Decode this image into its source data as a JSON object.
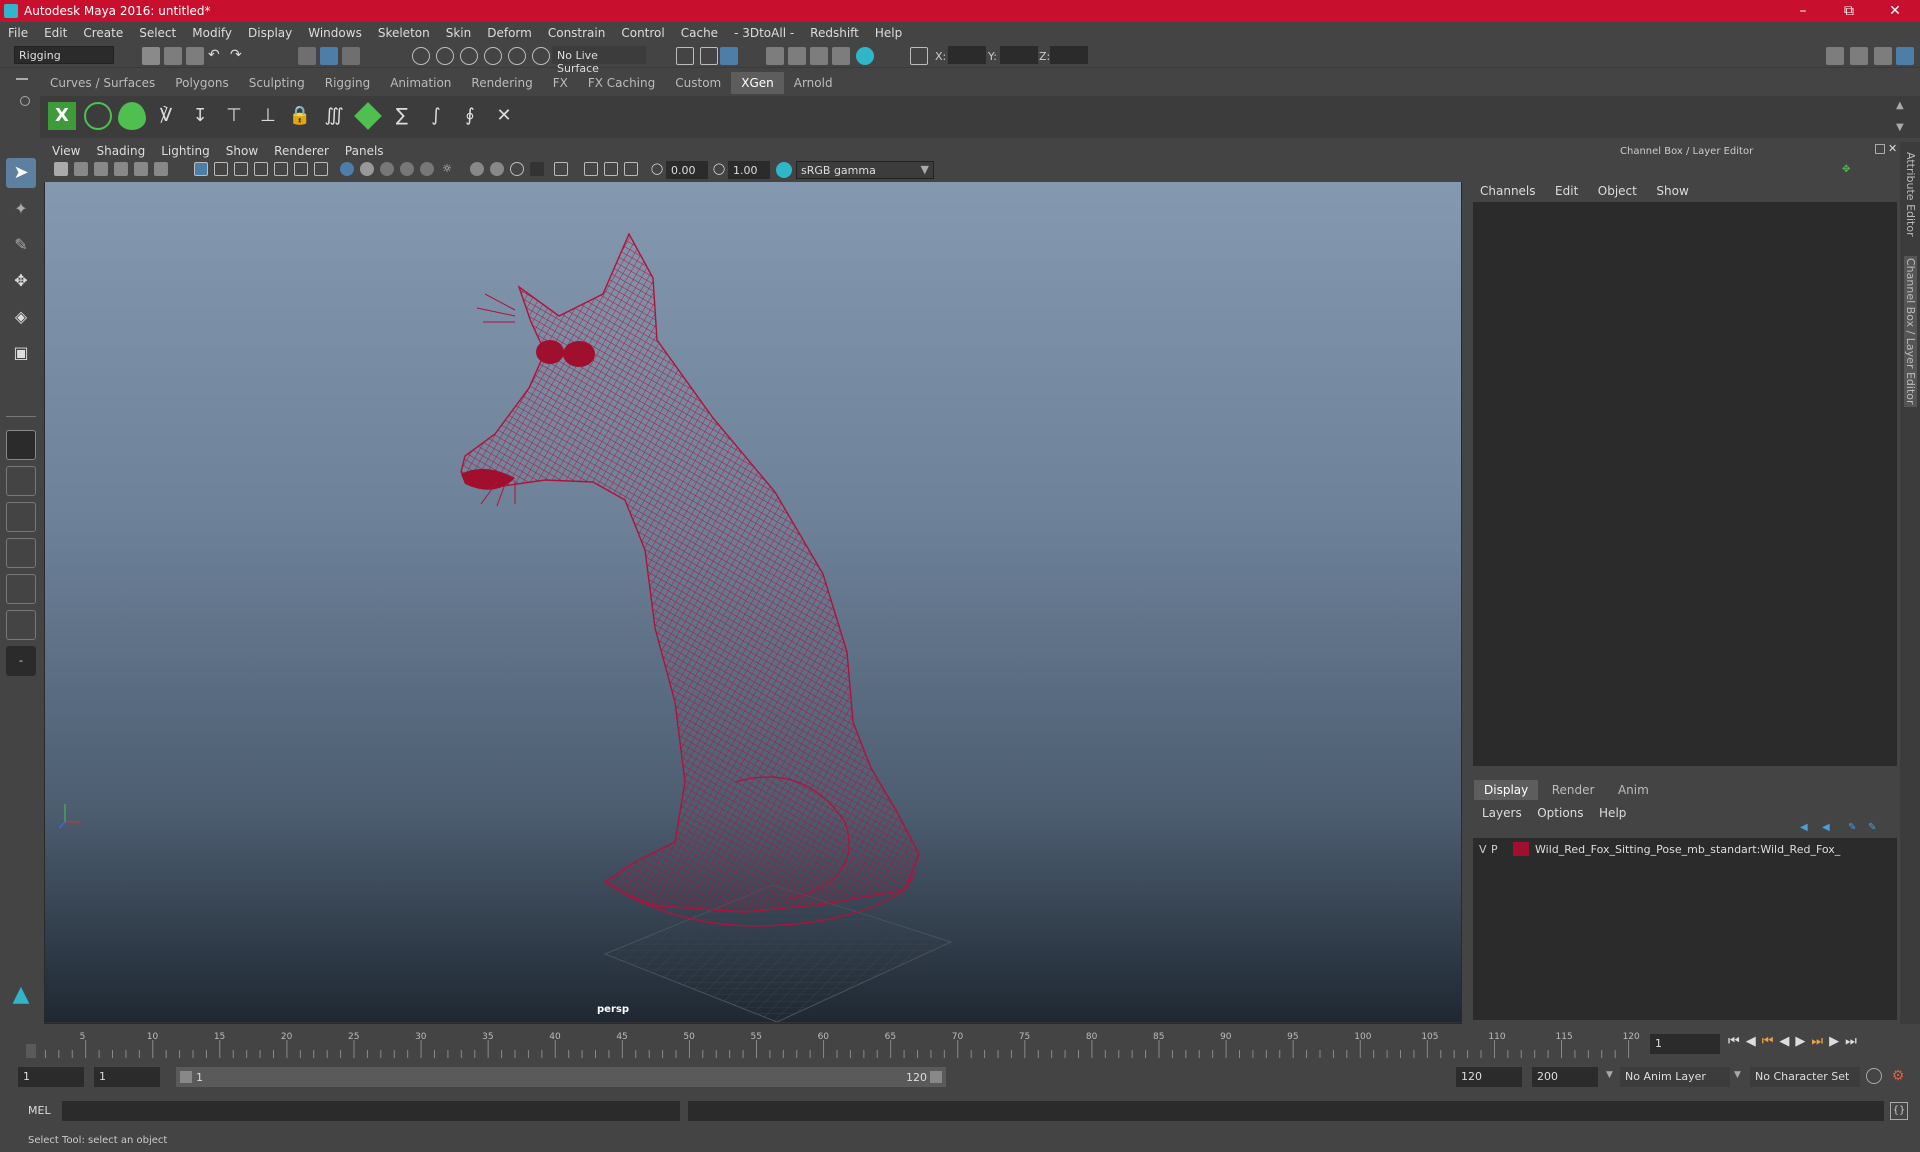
{
  "window": {
    "title": "Autodesk Maya 2016: untitled*"
  },
  "menubar": [
    "File",
    "Edit",
    "Create",
    "Select",
    "Modify",
    "Display",
    "Windows",
    "Skeleton",
    "Skin",
    "Deform",
    "Constrain",
    "Control",
    "Cache",
    "- 3DtoAll -",
    "Redshift",
    "Help"
  ],
  "statusline": {
    "mode": "Rigging",
    "live_surface": "No Live Surface",
    "x_label": "X:",
    "y_label": "Y:",
    "z_label": "Z:"
  },
  "shelf_tabs": [
    "Curves / Surfaces",
    "Polygons",
    "Sculpting",
    "Rigging",
    "Animation",
    "Rendering",
    "FX",
    "FX Caching",
    "Custom",
    "XGen",
    "Arnold"
  ],
  "active_shelf": "XGen",
  "viewport": {
    "menu": [
      "View",
      "Shading",
      "Lighting",
      "Show",
      "Renderer",
      "Panels"
    ],
    "exposure": "0.00",
    "gamma": "1.00",
    "color_space": "sRGB gamma",
    "camera": "persp"
  },
  "channel_box": {
    "title": "Channel Box / Layer Editor",
    "menu": [
      "Channels",
      "Edit",
      "Object",
      "Show"
    ]
  },
  "layer_editor": {
    "tabs": [
      "Display",
      "Render",
      "Anim"
    ],
    "active_tab": "Display",
    "menu": [
      "Layers",
      "Options",
      "Help"
    ],
    "layers": [
      {
        "v": "V",
        "p": "P",
        "color": "#a0102e",
        "name": "Wild_Red_Fox_Sitting_Pose_mb_standart:Wild_Red_Fox_"
      }
    ]
  },
  "side_tabs": [
    "Attribute Editor",
    "Channel Box / Layer Editor"
  ],
  "timeline": {
    "ticks": [
      "5",
      "10",
      "15",
      "20",
      "25",
      "30",
      "35",
      "40",
      "45",
      "50",
      "55",
      "60",
      "65",
      "70",
      "75",
      "80",
      "85",
      "90",
      "95",
      "100",
      "105",
      "110",
      "115",
      "120"
    ],
    "start_marker": "1",
    "current_frame": "1"
  },
  "range": {
    "start": "1",
    "playback_start": "1",
    "slider_start": "1",
    "slider_end": "120",
    "playback_end": "120",
    "end": "200",
    "anim_layer": "No Anim Layer",
    "character_set": "No Character Set"
  },
  "command": {
    "label": "MEL"
  },
  "help_line": "Select Tool: select an object",
  "colors": {
    "title_bar": "#c8102e",
    "wireframe": "#b0123c",
    "accent": "#2fb6c8"
  }
}
